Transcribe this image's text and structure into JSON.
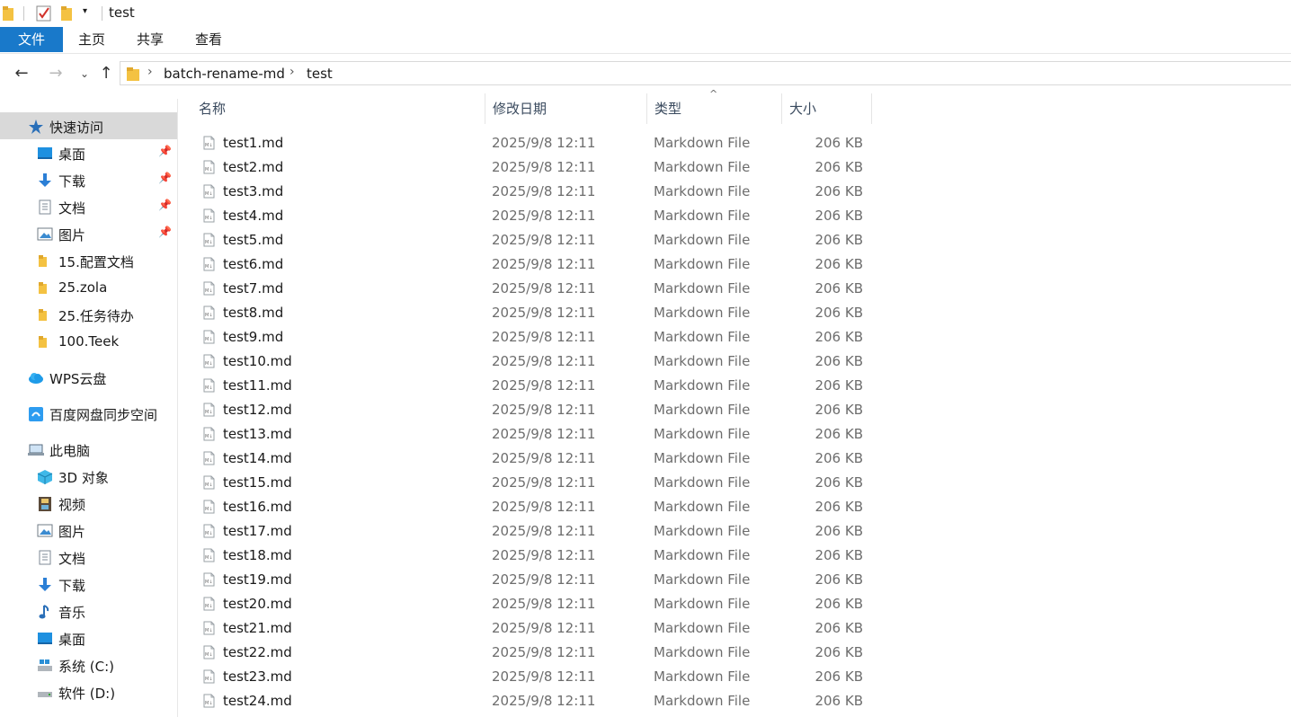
{
  "window": {
    "title": "test"
  },
  "ribbon": {
    "tabs": [
      "文件",
      "主页",
      "共享",
      "查看"
    ]
  },
  "breadcrumb": [
    "batch-rename-md",
    "test"
  ],
  "sidebar": {
    "quick_access": {
      "label": "快速访问",
      "items": [
        {
          "label": "桌面",
          "icon": "desktop-icon",
          "pinned": true
        },
        {
          "label": "下载",
          "icon": "download-icon",
          "pinned": true
        },
        {
          "label": "文档",
          "icon": "document-icon",
          "pinned": true
        },
        {
          "label": "图片",
          "icon": "pictures-icon",
          "pinned": true
        },
        {
          "label": "15.配置文档",
          "icon": "folder-icon",
          "pinned": false
        },
        {
          "label": "25.zola",
          "icon": "folder-icon",
          "pinned": false
        },
        {
          "label": "25.任务待办",
          "icon": "folder-icon",
          "pinned": false
        },
        {
          "label": "100.Teek",
          "icon": "folder-icon",
          "pinned": false
        }
      ]
    },
    "wps": {
      "label": "WPS云盘"
    },
    "baidu": {
      "label": "百度网盘同步空间"
    },
    "this_pc": {
      "label": "此电脑",
      "items": [
        {
          "label": "3D 对象",
          "icon": "3d-objects-icon"
        },
        {
          "label": "视频",
          "icon": "video-icon"
        },
        {
          "label": "图片",
          "icon": "pictures-icon"
        },
        {
          "label": "文档",
          "icon": "document-icon"
        },
        {
          "label": "下载",
          "icon": "download-icon"
        },
        {
          "label": "音乐",
          "icon": "music-icon"
        },
        {
          "label": "桌面",
          "icon": "desktop-icon"
        },
        {
          "label": "系统 (C:)",
          "icon": "drive-c-icon"
        },
        {
          "label": "软件 (D:)",
          "icon": "drive-d-icon"
        }
      ]
    }
  },
  "columns": [
    "名称",
    "修改日期",
    "类型",
    "大小"
  ],
  "files": [
    {
      "name": "test1.md",
      "date": "2025/9/8 12:11",
      "type": "Markdown File",
      "size": "206 KB"
    },
    {
      "name": "test2.md",
      "date": "2025/9/8 12:11",
      "type": "Markdown File",
      "size": "206 KB"
    },
    {
      "name": "test3.md",
      "date": "2025/9/8 12:11",
      "type": "Markdown File",
      "size": "206 KB"
    },
    {
      "name": "test4.md",
      "date": "2025/9/8 12:11",
      "type": "Markdown File",
      "size": "206 KB"
    },
    {
      "name": "test5.md",
      "date": "2025/9/8 12:11",
      "type": "Markdown File",
      "size": "206 KB"
    },
    {
      "name": "test6.md",
      "date": "2025/9/8 12:11",
      "type": "Markdown File",
      "size": "206 KB"
    },
    {
      "name": "test7.md",
      "date": "2025/9/8 12:11",
      "type": "Markdown File",
      "size": "206 KB"
    },
    {
      "name": "test8.md",
      "date": "2025/9/8 12:11",
      "type": "Markdown File",
      "size": "206 KB"
    },
    {
      "name": "test9.md",
      "date": "2025/9/8 12:11",
      "type": "Markdown File",
      "size": "206 KB"
    },
    {
      "name": "test10.md",
      "date": "2025/9/8 12:11",
      "type": "Markdown File",
      "size": "206 KB"
    },
    {
      "name": "test11.md",
      "date": "2025/9/8 12:11",
      "type": "Markdown File",
      "size": "206 KB"
    },
    {
      "name": "test12.md",
      "date": "2025/9/8 12:11",
      "type": "Markdown File",
      "size": "206 KB"
    },
    {
      "name": "test13.md",
      "date": "2025/9/8 12:11",
      "type": "Markdown File",
      "size": "206 KB"
    },
    {
      "name": "test14.md",
      "date": "2025/9/8 12:11",
      "type": "Markdown File",
      "size": "206 KB"
    },
    {
      "name": "test15.md",
      "date": "2025/9/8 12:11",
      "type": "Markdown File",
      "size": "206 KB"
    },
    {
      "name": "test16.md",
      "date": "2025/9/8 12:11",
      "type": "Markdown File",
      "size": "206 KB"
    },
    {
      "name": "test17.md",
      "date": "2025/9/8 12:11",
      "type": "Markdown File",
      "size": "206 KB"
    },
    {
      "name": "test18.md",
      "date": "2025/9/8 12:11",
      "type": "Markdown File",
      "size": "206 KB"
    },
    {
      "name": "test19.md",
      "date": "2025/9/8 12:11",
      "type": "Markdown File",
      "size": "206 KB"
    },
    {
      "name": "test20.md",
      "date": "2025/9/8 12:11",
      "type": "Markdown File",
      "size": "206 KB"
    },
    {
      "name": "test21.md",
      "date": "2025/9/8 12:11",
      "type": "Markdown File",
      "size": "206 KB"
    },
    {
      "name": "test22.md",
      "date": "2025/9/8 12:11",
      "type": "Markdown File",
      "size": "206 KB"
    },
    {
      "name": "test23.md",
      "date": "2025/9/8 12:11",
      "type": "Markdown File",
      "size": "206 KB"
    },
    {
      "name": "test24.md",
      "date": "2025/9/8 12:11",
      "type": "Markdown File",
      "size": "206 KB"
    }
  ],
  "colors": {
    "accent": "#1979ca",
    "folder": "#f4c242",
    "selected_bg": "#d9d9d9"
  }
}
